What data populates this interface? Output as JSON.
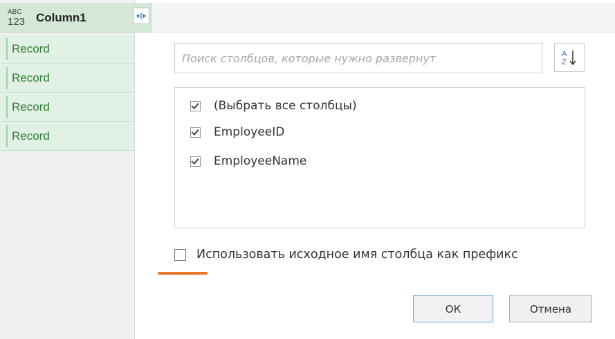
{
  "grid": {
    "column_type_abc": "ABC",
    "column_type_num": "123",
    "column_title": "Column1",
    "rows": [
      "Record",
      "Record",
      "Record",
      "Record"
    ]
  },
  "popup": {
    "search_placeholder": "Поиск столбцов, которые нужно развернут",
    "sort_icon": "sort-az-icon",
    "items": [
      {
        "label": "(Выбрать все столбцы)",
        "checked": true
      },
      {
        "label": "EmployeeID",
        "checked": true
      },
      {
        "label": "EmployeeName",
        "checked": true
      }
    ],
    "prefix_label": "Использовать исходное имя столбца как префикс",
    "prefix_checked": false,
    "ok_label": "ОК",
    "cancel_label": "Отмена"
  },
  "colors": {
    "record_green": "#2e7d32",
    "header_green": "#d4e8d8",
    "highlight_orange": "#e8772e"
  }
}
